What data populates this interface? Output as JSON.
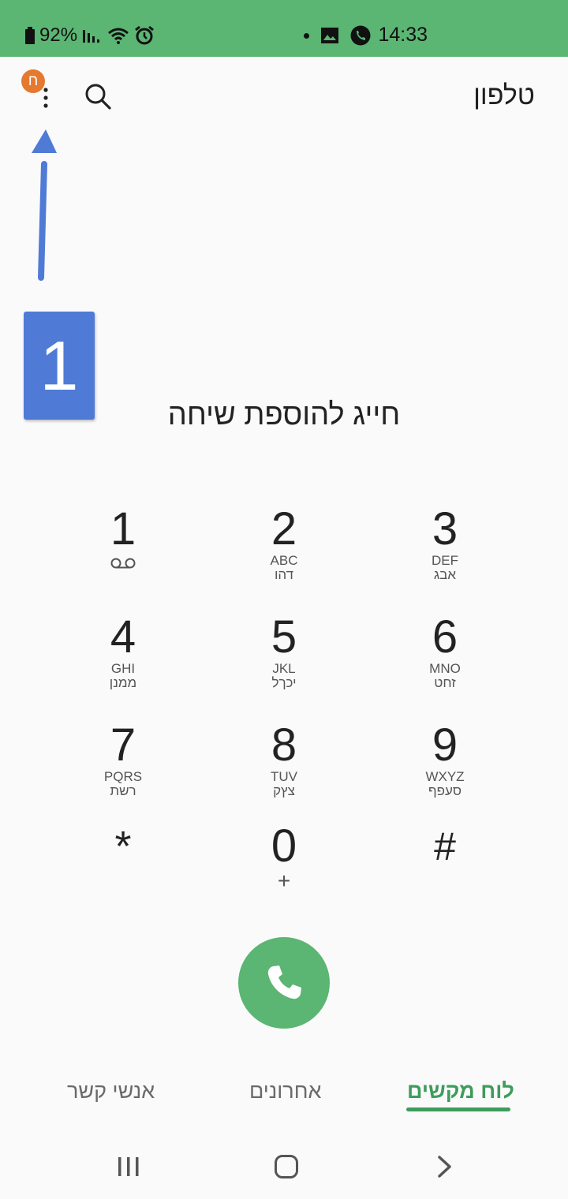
{
  "status_bar": {
    "battery": "92%",
    "time": "14:33"
  },
  "header": {
    "title": "טלפון",
    "badge": "ח"
  },
  "annotation": {
    "step": "1"
  },
  "dialer": {
    "placeholder": "חייג להוספת שיחה"
  },
  "keypad": [
    {
      "digit": "1",
      "letters": "",
      "heb": ""
    },
    {
      "digit": "2",
      "letters": "ABC",
      "heb": "דהו"
    },
    {
      "digit": "3",
      "letters": "DEF",
      "heb": "אבג"
    },
    {
      "digit": "4",
      "letters": "GHI",
      "heb": "ממנן"
    },
    {
      "digit": "5",
      "letters": "JKL",
      "heb": "יכךל"
    },
    {
      "digit": "6",
      "letters": "MNO",
      "heb": "זחט"
    },
    {
      "digit": "7",
      "letters": "PQRS",
      "heb": "רשת"
    },
    {
      "digit": "8",
      "letters": "TUV",
      "heb": "צץק"
    },
    {
      "digit": "9",
      "letters": "WXYZ",
      "heb": "סעפף"
    },
    {
      "digit": "*",
      "letters": "",
      "heb": ""
    },
    {
      "digit": "0",
      "letters": "+",
      "heb": ""
    },
    {
      "digit": "#",
      "letters": "",
      "heb": ""
    }
  ],
  "tabs": {
    "keypad": "לוח מקשים",
    "recents": "אחרונים",
    "contacts": "אנשי קשר"
  },
  "colors": {
    "accent": "#5bb573",
    "active_tab": "#3e9c5c",
    "annotation": "#4f7bd7",
    "badge": "#e4792f"
  }
}
